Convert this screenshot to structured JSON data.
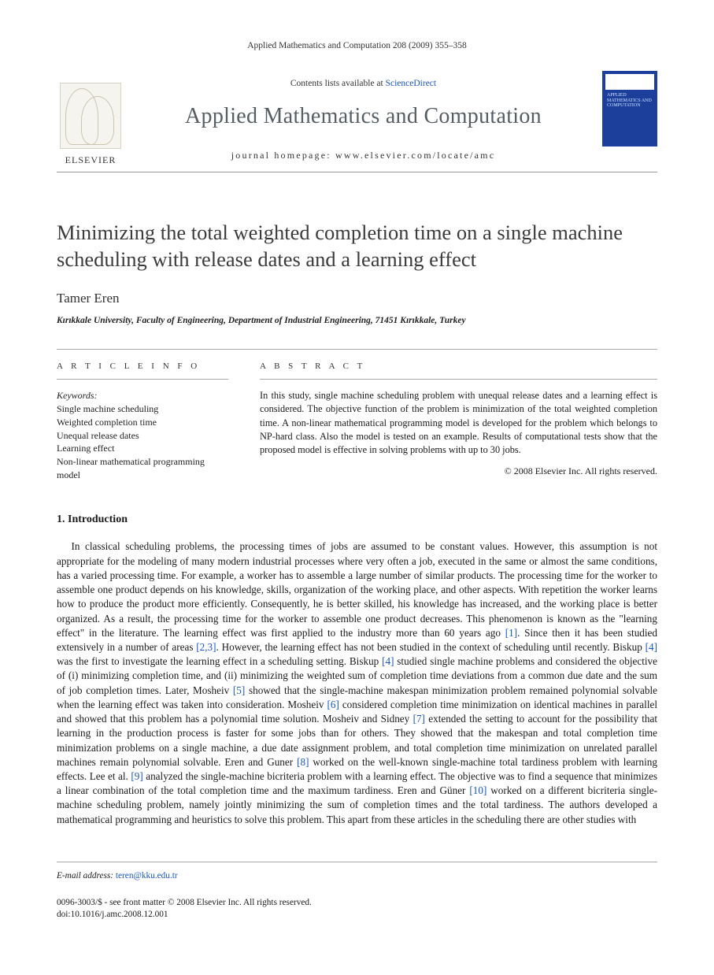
{
  "running_head": "Applied Mathematics and Computation 208 (2009) 355–358",
  "masthead": {
    "contents_prefix": "Contents lists available at ",
    "contents_link": "ScienceDirect",
    "journal": "Applied Mathematics and Computation",
    "homepage_label": "journal homepage: www.elsevier.com/locate/amc",
    "publisher_wordmark": "ELSEVIER",
    "cover_text": "APPLIED MATHEMATICS AND COMPUTATION"
  },
  "article": {
    "title": "Minimizing the total weighted completion time on a single machine scheduling with release dates and a learning effect",
    "author": "Tamer Eren",
    "affiliation": "Kırıkkale University, Faculty of Engineering, Department of Industrial Engineering, 71451 Kırıkkale, Turkey"
  },
  "headings": {
    "article_info": "A R T I C L E   I N F O",
    "abstract": "A B S T R A C T",
    "keywords_label": "Keywords:",
    "intro": "1. Introduction"
  },
  "keywords": [
    "Single machine scheduling",
    "Weighted completion time",
    "Unequal release dates",
    "Learning effect",
    "Non-linear mathematical programming model"
  ],
  "abstract": {
    "body": "In this study, single machine scheduling problem with unequal release dates and a learning effect is considered. The objective function of the problem is minimization of the total weighted completion time. A non-linear mathematical programming model is developed for the problem which belongs to NP-hard class. Also the model is tested on an example. Results of computational tests show that the proposed model is effective in solving problems with up to 30 jobs.",
    "copyright": "© 2008 Elsevier Inc. All rights reserved."
  },
  "body": {
    "intro_text_parts": [
      "In classical scheduling problems, the processing times of jobs are assumed to be constant values. However, this assumption is not appropriate for the modeling of many modern industrial processes where very often a job, executed in the same or almost the same conditions, has a varied processing time. For example, a worker has to assemble a large number of similar products. The processing time for the worker to assemble one product depends on his knowledge, skills, organization of the working place, and other aspects. With repetition the worker learns how to produce the product more efficiently. Consequently, he is better skilled, his knowledge has increased, and the working place is better organized. As a result, the processing time for the worker to assemble one product decreases. This phenomenon is known as the \"learning effect\" in the literature. The learning effect was first applied to the industry more than 60 years ago ",
      ". Since then it has been studied extensively in a number of areas ",
      ". However, the learning effect has not been studied in the context of scheduling until recently. Biskup ",
      " was the first to investigate the learning effect in a scheduling setting. Biskup ",
      " studied single machine problems and considered the objective of (i) minimizing completion time, and (ii) minimizing the weighted sum of completion time deviations from a common due date and the sum of job completion times. Later, Mosheiv ",
      " showed that the single-machine makespan minimization problem remained polynomial solvable when the learning effect was taken into consideration. Mosheiv ",
      " considered completion time minimization on identical machines in parallel and showed that this problem has a polynomial time solution. Mosheiv and Sidney ",
      " extended the setting to account for the possibility that learning in the production process is faster for some jobs than for others. They showed that the makespan and total completion time minimization problems on a single machine, a due date assignment problem, and total completion time minimization on unrelated parallel machines remain polynomial solvable. Eren and Guner ",
      " worked on the well-known single-machine total tardiness problem with learning effects. Lee et al. ",
      " analyzed the single-machine bicriteria problem with a learning effect. The objective was to find a sequence that minimizes a linear combination of the total completion time and the maximum tardiness. Eren and Güner ",
      " worked on a different bicriteria single-machine scheduling problem, namely jointly minimizing the sum of completion times and the total tardiness. The authors developed a mathematical programming and heuristics to solve this problem. This apart from these articles in the scheduling there are other studies with"
    ],
    "refs": [
      "[1]",
      "[2,3]",
      "[4]",
      "[4]",
      "[5]",
      "[6]",
      "[7]",
      "[8]",
      "[9]",
      "[10]"
    ]
  },
  "footer": {
    "email_label": "E-mail address:",
    "email": "teren@kku.edu.tr",
    "issn_line": "0096-3003/$ - see front matter © 2008 Elsevier Inc. All rights reserved.",
    "doi_line": "doi:10.1016/j.amc.2008.12.001"
  }
}
